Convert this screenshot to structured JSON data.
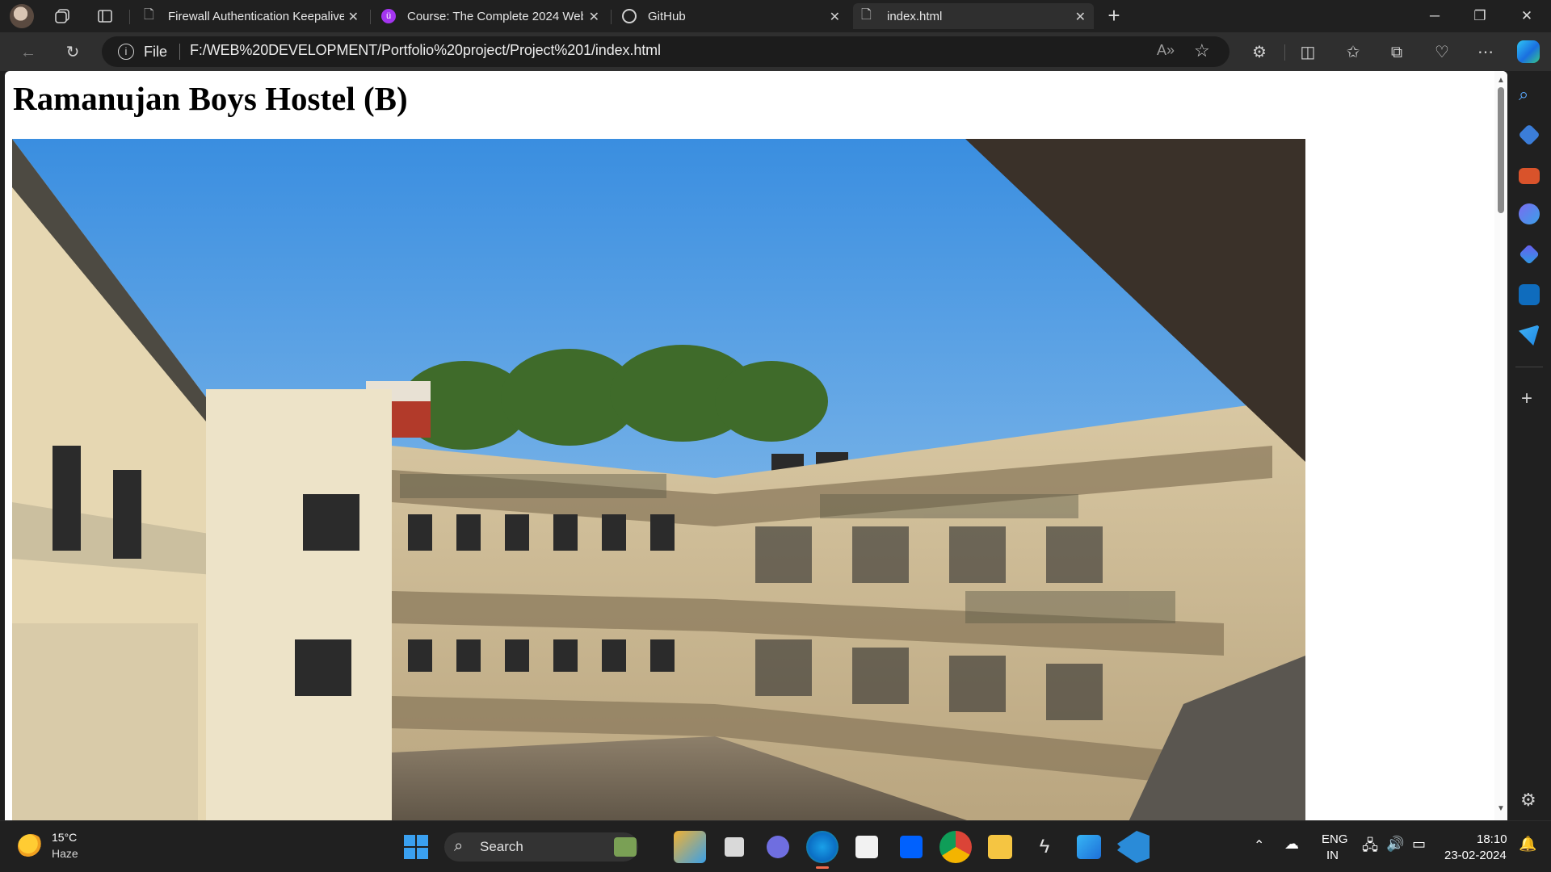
{
  "browser": {
    "tabs": [
      {
        "title": "Firewall Authentication Keepalive",
        "active": false
      },
      {
        "title": "Course: The Complete 2024 Web",
        "active": false
      },
      {
        "title": "GitHub",
        "active": false
      },
      {
        "title": "index.html",
        "active": true
      }
    ],
    "new_tab_label": "+",
    "address": {
      "scheme_label": "File",
      "url": "F:/WEB%20DEVELOPMENT/Portfolio%20project/Project%201/index.html"
    }
  },
  "page": {
    "heading": "Ramanujan Boys Hostel (B)"
  },
  "taskbar": {
    "weather": {
      "temp": "15°C",
      "condition": "Haze"
    },
    "search_placeholder": "Search",
    "lang_line1": "ENG",
    "lang_line2": "IN",
    "time": "18:10",
    "date": "23-02-2024"
  },
  "colors": {
    "sky_top": "#3a8ee0",
    "sky_bottom": "#a9d0ee",
    "building_wall": "#e6d7b2",
    "accent_blue": "#2b84e0"
  }
}
